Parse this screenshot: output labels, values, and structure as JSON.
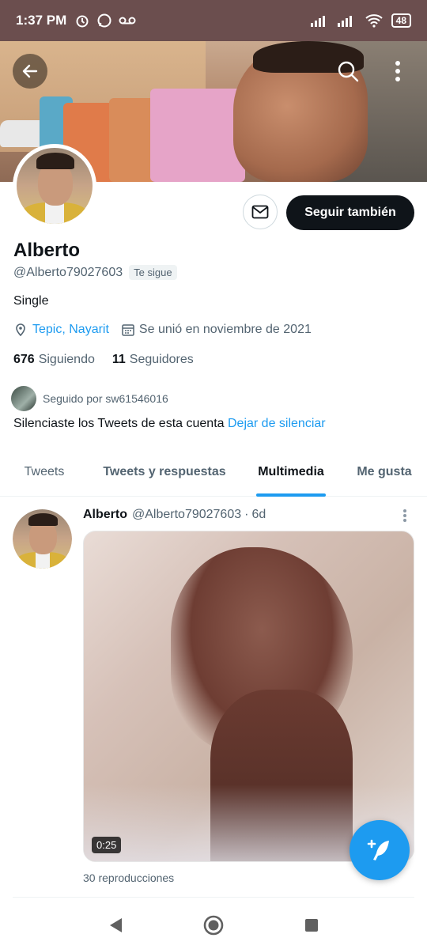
{
  "status_bar": {
    "time": "1:37 PM",
    "battery": "48",
    "background_color": "#6b4e4e"
  },
  "profile": {
    "name": "Alberto",
    "handle": "@Alberto79027603",
    "follows_you": "Te sigue",
    "bio": "Single",
    "location": "Tepic, Nayarit",
    "joined": "Se unió en noviembre de 2021",
    "following_count": "676",
    "following_label": "Siguiendo",
    "followers_count": "11",
    "followers_label": "Seguidores",
    "followed_by": "Seguido por sw61546016",
    "muted_text": "Silenciaste los Tweets de esta cuenta",
    "unmute_link": "Dejar de silenciar",
    "follow_button": "Seguir también"
  },
  "tabs": [
    {
      "label": "Tweets",
      "active": false
    },
    {
      "label": "Tweets y respuestas",
      "active": false
    },
    {
      "label": "Multimedia",
      "active": true
    },
    {
      "label": "Me gusta",
      "active": false
    }
  ],
  "tweet": {
    "name": "Alberto",
    "handle": "@Alberto79027603",
    "separator": "·",
    "time": "6d",
    "video_duration": "0:25",
    "views": "30 reproducciones"
  },
  "icons": [
    "back-arrow-icon",
    "search-icon",
    "more-vertical-icon",
    "envelope-icon",
    "location-pin-icon",
    "calendar-icon",
    "compose-tweet-icon",
    "nav-back-icon",
    "nav-home-icon",
    "nav-recents-icon"
  ],
  "colors": {
    "accent": "#1d9bf0",
    "text_primary": "#0f1419",
    "text_secondary": "#536471"
  }
}
